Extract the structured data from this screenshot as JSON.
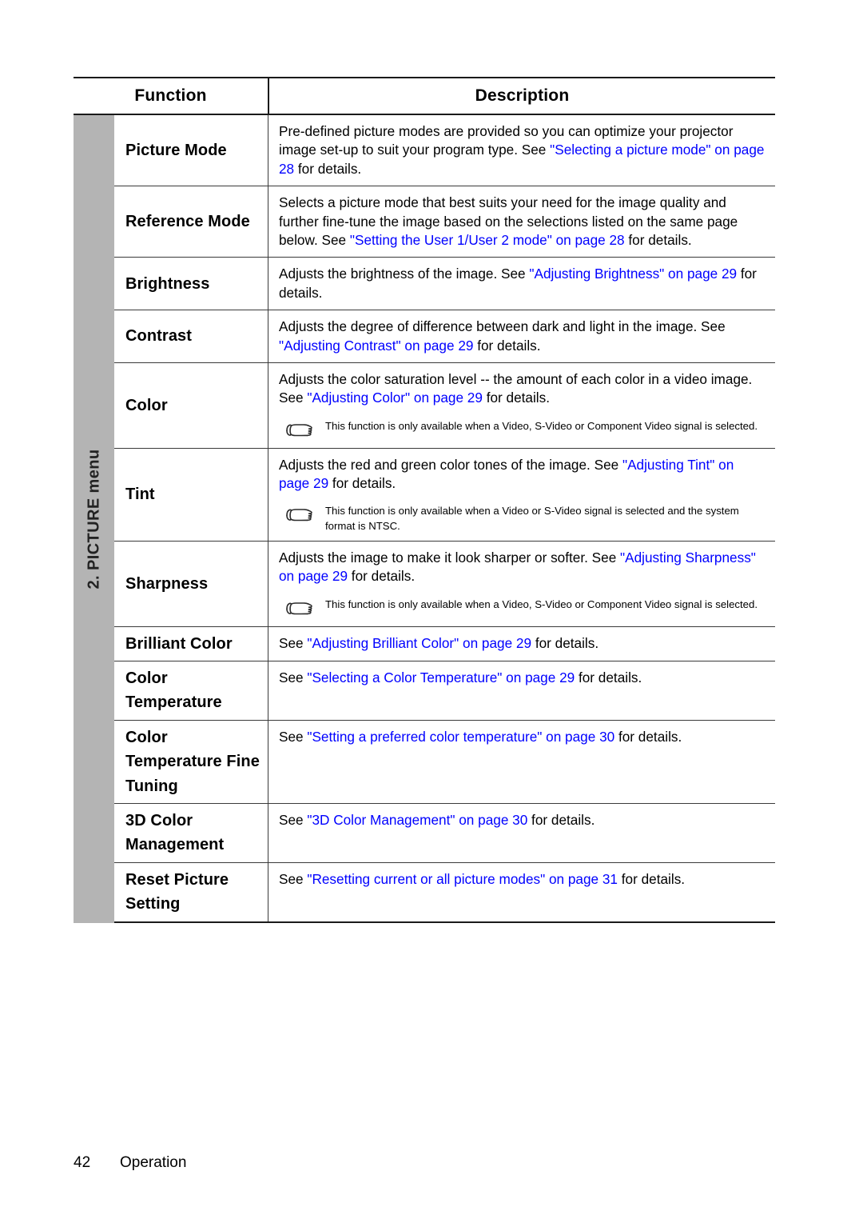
{
  "document": {
    "table": {
      "columns": [
        "Function",
        "Description"
      ],
      "sidebar_label": "2. PICTURE menu",
      "rows": [
        {
          "function": "Picture Mode",
          "desc_parts": [
            {
              "t": "Pre-defined picture modes are provided so you can optimize your projector image set-up to suit your program type. See ",
              "link": false
            },
            {
              "t": "\"Selecting a picture mode\" on page 28",
              "link": true
            },
            {
              "t": " for details.",
              "link": false
            }
          ],
          "note": null
        },
        {
          "function": "Reference Mode",
          "desc_parts": [
            {
              "t": "Selects a picture mode that best suits your need for the image quality and further fine-tune the image based on the selections listed on the same page below. See ",
              "link": false
            },
            {
              "t": "\"Setting the User 1/User 2 mode\" on page 28",
              "link": true
            },
            {
              "t": " for details.",
              "link": false
            }
          ],
          "note": null
        },
        {
          "function": "Brightness",
          "desc_parts": [
            {
              "t": "Adjusts the brightness of the image. See ",
              "link": false
            },
            {
              "t": "\"Adjusting Brightness\" on page 29",
              "link": true
            },
            {
              "t": " for details.",
              "link": false
            }
          ],
          "note": null
        },
        {
          "function": "Contrast",
          "desc_parts": [
            {
              "t": "Adjusts the degree of difference between dark and light in the image. See ",
              "link": false
            },
            {
              "t": "\"Adjusting Contrast\" on page 29",
              "link": true
            },
            {
              "t": " for details.",
              "link": false
            }
          ],
          "note": null
        },
        {
          "function": "Color",
          "desc_parts": [
            {
              "t": "Adjusts the color saturation level -- the amount of each color in a video image. See ",
              "link": false
            },
            {
              "t": "\"Adjusting Color\" on page 29",
              "link": true
            },
            {
              "t": " for details.",
              "link": false
            }
          ],
          "note": "This function is only available when a Video, S-Video or Component Video signal is selected."
        },
        {
          "function": "Tint",
          "desc_parts": [
            {
              "t": "Adjusts the red and green color tones of the image. See ",
              "link": false
            },
            {
              "t": "\"Adjusting Tint\" on page 29",
              "link": true
            },
            {
              "t": " for details.",
              "link": false
            }
          ],
          "note": "This function is only available when a Video or S-Video signal is selected and the system format is NTSC."
        },
        {
          "function": "Sharpness",
          "desc_parts": [
            {
              "t": "Adjusts the image to make it look sharper or softer. See ",
              "link": false
            },
            {
              "t": "\"Adjusting Sharpness\" on page 29",
              "link": true
            },
            {
              "t": " for details.",
              "link": false
            }
          ],
          "note": "This function is only available when a Video, S-Video or Component Video signal is selected."
        },
        {
          "function": "Brilliant Color",
          "desc_parts": [
            {
              "t": "See ",
              "link": false
            },
            {
              "t": "\"Adjusting Brilliant Color\" on page 29",
              "link": true
            },
            {
              "t": " for details.",
              "link": false
            }
          ],
          "note": null
        },
        {
          "function": "Color Temperature",
          "desc_parts": [
            {
              "t": "See ",
              "link": false
            },
            {
              "t": "\"Selecting a Color Temperature\" on page 29",
              "link": true
            },
            {
              "t": " for details.",
              "link": false
            }
          ],
          "note": null
        },
        {
          "function": "Color Temperature Fine Tuning",
          "desc_parts": [
            {
              "t": "See ",
              "link": false
            },
            {
              "t": "\"Setting a preferred color temperature\" on page 30",
              "link": true
            },
            {
              "t": " for details.",
              "link": false
            }
          ],
          "note": null
        },
        {
          "function": "3D Color Management",
          "desc_parts": [
            {
              "t": "See ",
              "link": false
            },
            {
              "t": "\"3D Color Management\" on page 30",
              "link": true
            },
            {
              "t": " for details.",
              "link": false
            }
          ],
          "note": null
        },
        {
          "function": "Reset Picture Setting",
          "desc_parts": [
            {
              "t": "See ",
              "link": false
            },
            {
              "t": "\"Resetting current or all picture modes\" on page 31",
              "link": true
            },
            {
              "t": " for details.",
              "link": false
            }
          ],
          "note": null
        }
      ]
    },
    "footer": {
      "page_number": "42",
      "section": "Operation"
    },
    "colors": {
      "link": "#0000FF",
      "sidebar_gray": "#B4B4B4",
      "text": "#000000"
    },
    "icons": {
      "note": "pointing-hand-icon"
    }
  }
}
